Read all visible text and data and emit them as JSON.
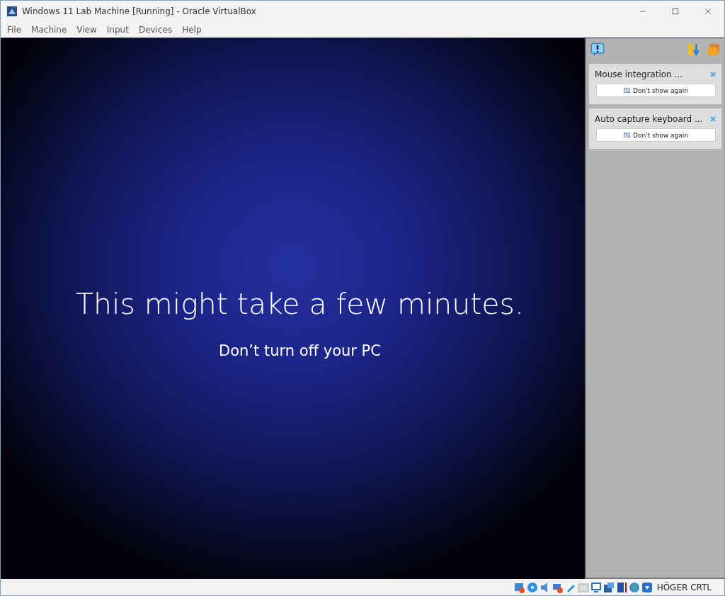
{
  "window": {
    "title": "Windows 11 Lab Machine [Running] - Oracle VirtualBox"
  },
  "menu": [
    "File",
    "Machine",
    "View",
    "Input",
    "Devices",
    "Help"
  ],
  "guest_screen": {
    "heading": "This might take a few minutes.",
    "subtext": "Don’t turn off your PC"
  },
  "notifications": [
    {
      "title": "Mouse integration ...",
      "button": "Don't show again"
    },
    {
      "title": "Auto capture keyboard ...",
      "button": "Don't show again"
    }
  ],
  "status_bar": {
    "host_key": "HÖGER CRTL"
  }
}
